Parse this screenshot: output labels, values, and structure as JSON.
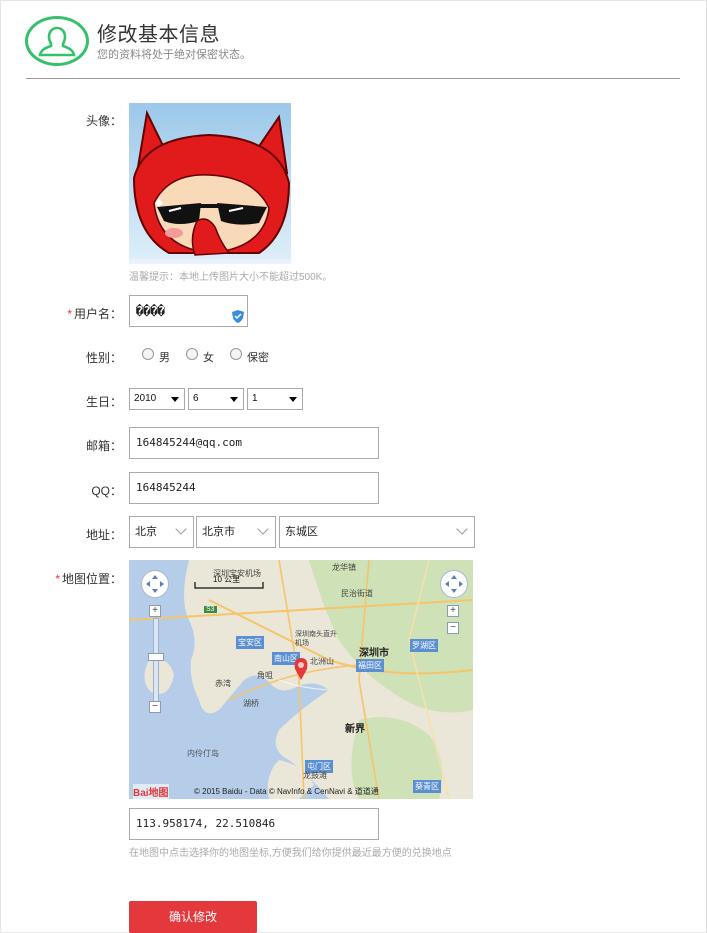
{
  "header": {
    "title": "修改基本信息",
    "subtitle": "您的资料将处于绝对保密状态。",
    "icon": "user-profile-icon",
    "accent_color": "#35c16b"
  },
  "form": {
    "avatar": {
      "label": "头像：",
      "hint": "温馨提示：本地上传图片大小不能超过500K。"
    },
    "username": {
      "required_mark": "*",
      "label": "用户名：",
      "value": "����"
    },
    "gender": {
      "label": "性别：",
      "options": [
        "男",
        "女",
        "保密"
      ]
    },
    "birthday": {
      "label": "生日：",
      "year": "2010",
      "month": "6",
      "day": "1"
    },
    "email": {
      "label": "邮箱：",
      "value": "164845244@qq.com"
    },
    "qq": {
      "label": "QQ：",
      "value": "164845244"
    },
    "address": {
      "label": "地址：",
      "province": "北京",
      "city": "北京市",
      "district": "东城区"
    },
    "map_position": {
      "required_mark": "*",
      "label": "地图位置：",
      "scale_label": "10 公里",
      "place_labels": [
        "深圳宝安机场",
        "龙华镇",
        "民治街道",
        "宝安区",
        "深圳南头直升机场",
        "罗湖区",
        "南山区",
        "北洲山",
        "深圳市",
        "福田区",
        "角咀",
        "赤湾",
        "新界",
        "屯门区",
        "龙鼓滩",
        "葵青区",
        "内伶仃岛",
        "湖桥",
        "S3"
      ],
      "attribution": "© 2015 Baidu - Data © NavInfo & CenNavi & 道道通",
      "baidu_logo": "Bai地图",
      "coordinates": "113.958174, 22.510846",
      "hint": "在地图中点击选择你的地图坐标,方便我们给你提供最近最方便的兑换地点"
    },
    "submit_label": "确认修改",
    "submit_color": "#e4393c"
  }
}
